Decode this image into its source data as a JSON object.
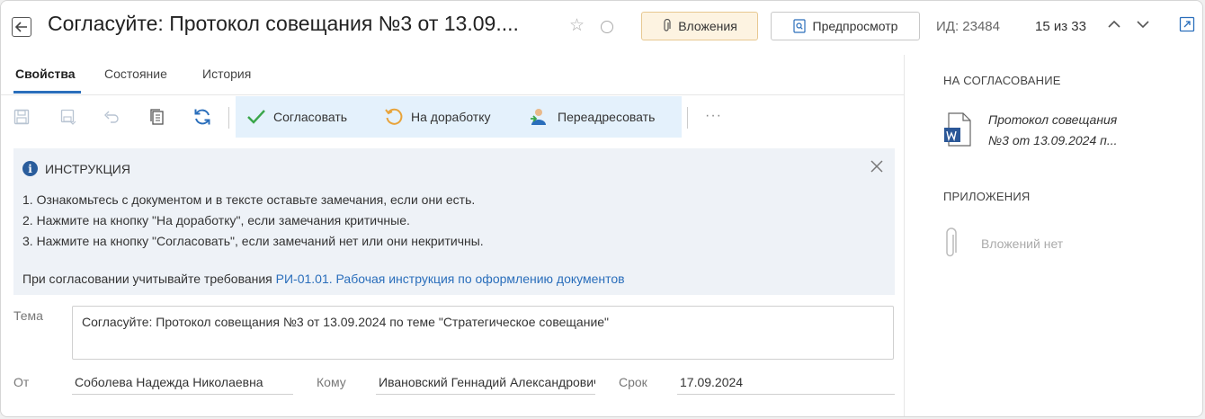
{
  "header": {
    "title": "Согласуйте: Протокол совещания №3 от 13.09....",
    "attachments_label": "Вложения",
    "preview_label": "Предпросмотр",
    "doc_id": "ИД: 23484",
    "pager": "15 из 33"
  },
  "tabs": [
    {
      "label": "Свойства",
      "active": true
    },
    {
      "label": "Состояние",
      "active": false
    },
    {
      "label": "История",
      "active": false
    }
  ],
  "toolbar": {
    "approve_label": "Согласовать",
    "rework_label": "На доработку",
    "redirect_label": "Переадресовать",
    "more_label": "···"
  },
  "instruction": {
    "title": "ИНСТРУКЦИЯ",
    "lines": [
      "1. Ознакомьтесь с документом и в тексте оставьте замечания, если они есть.",
      "2. Нажмите на кнопку \"На доработку\", если замечания критичные.",
      "3. Нажмите на кнопку \"Согласовать\", если замечаний нет или они некритичны."
    ],
    "requirements_prefix": "При согласовании учитывайте требования",
    "requirements_link": "РИ-01.01. Рабочая инструкция по оформлению документов"
  },
  "form": {
    "subject_label": "Тема",
    "subject_value": "Согласуйте: Протокол совещания №3 от 13.09.2024 по теме \"Стратегическое совещание\"",
    "from_label": "От",
    "from_value": "Соболева Надежда Николаевна",
    "to_label": "Кому",
    "to_value": "Ивановский Геннадий Александрович",
    "deadline_label": "Срок",
    "deadline_value": "17.09.2024"
  },
  "right_panel": {
    "approval_heading": "НА СОГЛАСОВАНИЕ",
    "document_line1": "Протокол совещания",
    "document_line2": "№3 от 13.09.2024 п...",
    "attachments_heading": "ПРИЛОЖЕНИЯ",
    "attachments_empty": "Вложений нет"
  },
  "colors": {
    "accent": "#2a6ebb",
    "toolbar_highlight": "#e4f1fc",
    "instruction_bg": "#eef2f7",
    "attach_button_bg": "#fdf3e1",
    "approve_check": "#3aa64a",
    "rework_arrow": "#e8a33a"
  }
}
